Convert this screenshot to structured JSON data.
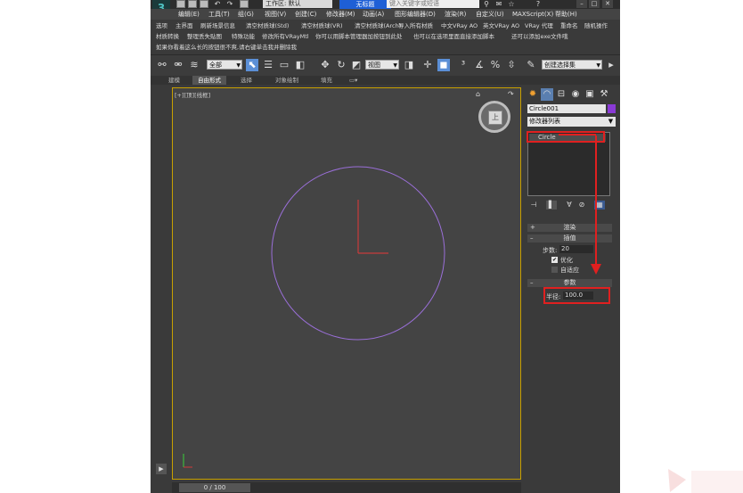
{
  "titlebar": {
    "workspace_label": "工作区: 默认",
    "app_title": "无标题",
    "search_placeholder": "键入关键字或短语"
  },
  "menu": {
    "items": [
      "编辑(E)",
      "工具(T)",
      "组(G)",
      "视图(V)",
      "创建(C)",
      "修改器(M)",
      "动画(A)",
      "图形编辑器(D)",
      "渲染(R)",
      "自定义(U)",
      "MAXScript(X)",
      "帮助(H)"
    ]
  },
  "commands": {
    "row1": [
      "选项",
      "主界面",
      "刷新场景信息",
      "清空材质球(Std)",
      "清空材质球(VR)",
      "清空材质球(Arch)",
      "导入所有材质",
      "中文VRay AO",
      "英文VRay AO",
      "VRay 代理",
      "重命名",
      "随机操作"
    ],
    "row2": [
      "材质转换",
      "整理丢失贴图",
      "特殊功能",
      "修改所有VRayMtl",
      "你可以用脚本管理器加按钮到此处",
      "也可以在选项里面直接添加脚本",
      "还可以添加exe文件哦"
    ],
    "row3": [
      "如果你看着这么长的按钮很不爽,请右键单击我并删除我"
    ]
  },
  "toolbar": {
    "selection_filter": "全部",
    "reference_coord": "视图",
    "named_selection": "创建选择集"
  },
  "ribbon": {
    "tabs": [
      "建模",
      "自由形式",
      "选择",
      "对象绘制",
      "填充"
    ]
  },
  "viewport": {
    "label": "[+][顶][线框]",
    "viewcube_face": "上"
  },
  "command_panel": {
    "object_name": "Circle001",
    "object_color": "#8a3ad6",
    "modifier_list": "修改器列表",
    "stack_item": "Circle",
    "rollout_render": "渲染",
    "rollout_interp": "插值",
    "steps_label": "步数:",
    "steps_value": "20",
    "optimize_label": "优化",
    "adaptive_label": "自适应",
    "rollout_params": "参数",
    "radius_label": "半径:",
    "radius_value": "100.0"
  },
  "timeline": {
    "slider_text": "0 / 100"
  }
}
